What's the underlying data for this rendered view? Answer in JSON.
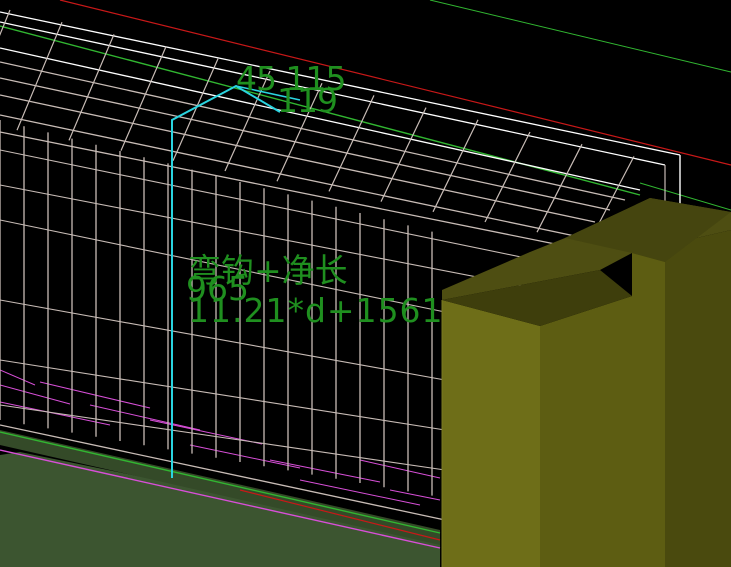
{
  "viewport": {
    "background": "#000000",
    "labels": {
      "top_primary": "45 115",
      "top_secondary": "119",
      "formula_name": "弯钩+净长",
      "formula_value_partial": "965",
      "formula_expression": "11.21*d+1561"
    },
    "colors": {
      "label_text": "#1f8f1f",
      "rebar_wire": "#c8bcb6",
      "rebar_highlight": "#ffffff",
      "selected_bar": "#2ad4e0",
      "axis_green": "#31b631",
      "axis_red": "#c81818",
      "ground_magenta": "#d84fd8",
      "slab_fill": "#3c5530",
      "column_face_light": "#6e6e18",
      "column_face_mid": "#5d5d12",
      "column_face_dark": "#4a4a0e"
    }
  }
}
